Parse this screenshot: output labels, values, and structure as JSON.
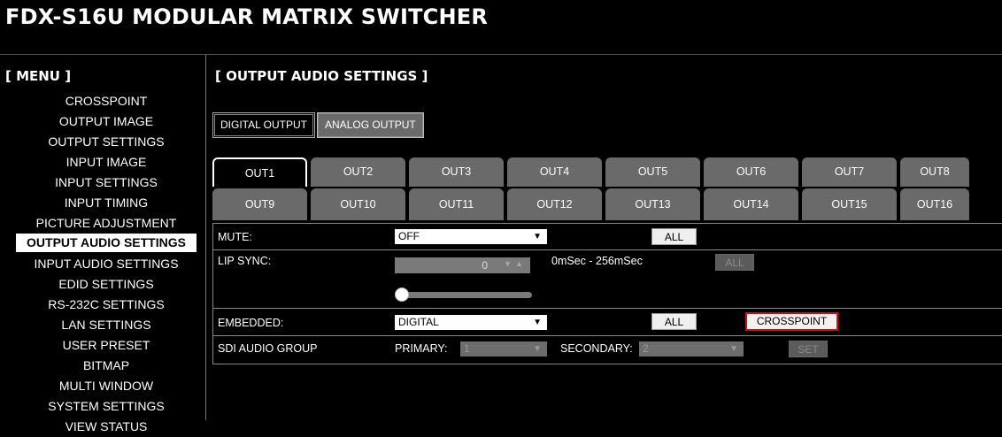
{
  "app": {
    "title": "FDX-S16U MODULAR MATRIX SWITCHER"
  },
  "menu": {
    "title": "[ MENU ]",
    "items": [
      {
        "label": "CROSSPOINT",
        "active": false
      },
      {
        "label": "OUTPUT IMAGE",
        "active": false
      },
      {
        "label": "OUTPUT SETTINGS",
        "active": false
      },
      {
        "label": "INPUT IMAGE",
        "active": false
      },
      {
        "label": "INPUT SETTINGS",
        "active": false
      },
      {
        "label": "INPUT TIMING",
        "active": false
      },
      {
        "label": "PICTURE ADJUSTMENT",
        "active": false
      },
      {
        "label": "OUTPUT AUDIO SETTINGS",
        "active": true
      },
      {
        "label": "INPUT AUDIO SETTINGS",
        "active": false
      },
      {
        "label": "EDID SETTINGS",
        "active": false
      },
      {
        "label": "RS-232C SETTINGS",
        "active": false
      },
      {
        "label": "LAN SETTINGS",
        "active": false
      },
      {
        "label": "USER PRESET",
        "active": false
      },
      {
        "label": "BITMAP",
        "active": false
      },
      {
        "label": "MULTI WINDOW",
        "active": false
      },
      {
        "label": "SYSTEM SETTINGS",
        "active": false
      },
      {
        "label": "VIEW STATUS",
        "active": false
      }
    ]
  },
  "main": {
    "section_title": "[ OUTPUT AUDIO SETTINGS ]",
    "type_tabs": [
      {
        "label": "DIGITAL OUTPUT",
        "active": true
      },
      {
        "label": "ANALOG OUTPUT",
        "active": false
      }
    ],
    "output_tabs": {
      "row1": [
        "OUT1",
        "OUT2",
        "OUT3",
        "OUT4",
        "OUT5",
        "OUT6",
        "OUT7",
        "OUT8"
      ],
      "row2": [
        "OUT9",
        "OUT10",
        "OUT11",
        "OUT12",
        "OUT13",
        "OUT14",
        "OUT15",
        "OUT16"
      ],
      "selected": "OUT1"
    },
    "settings": {
      "mute": {
        "label": "MUTE:",
        "value": "OFF",
        "all_button": "ALL"
      },
      "lip_sync": {
        "label": "LIP SYNC:",
        "value": "0",
        "range_text": "0mSec - 256mSec",
        "all_button": "ALL",
        "slider_fraction": 0
      },
      "embedded": {
        "label": "EMBEDDED:",
        "value": "DIGITAL",
        "all_button": "ALL",
        "crosspoint_button": "CROSSPOINT"
      },
      "sdi_audio_group": {
        "label": "SDI AUDIO GROUP",
        "primary_label": "PRIMARY:",
        "primary_value": "1",
        "secondary_label": "SECONDARY:",
        "secondary_value": "2",
        "set_button": "SET"
      }
    }
  },
  "colors": {
    "background": "#000000",
    "tab_inactive": "#6a6a6a",
    "highlight_border": "#cc1111"
  }
}
